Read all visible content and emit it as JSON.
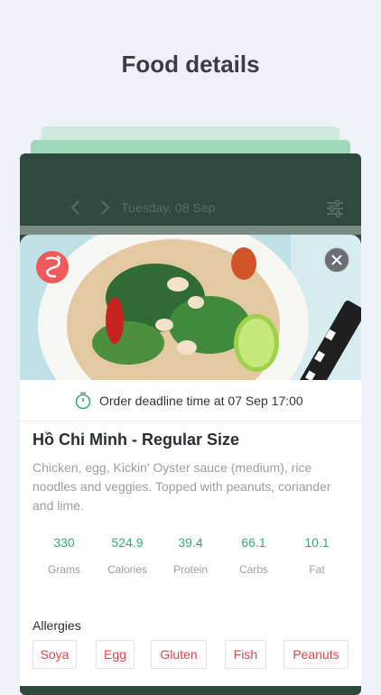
{
  "headline": "Food details",
  "topbar": {
    "date": "Tuesday, 08 Sep",
    "prev_icon": "chevron-left-icon",
    "next_icon": "chevron-right-icon",
    "filter_icon": "sliders-icon"
  },
  "card": {
    "deadline": "Order deadline time at 07 Sep 17:00",
    "title": "Hồ Chi Minh - Regular Size",
    "description": "Chicken, egg, Kickin' Oyster sauce (medium), rice noodles and veggies. Topped with peanuts, coriander and lime.",
    "nutrition": [
      {
        "value": "330",
        "label": "Grams"
      },
      {
        "value": "524.9",
        "label": "Calories"
      },
      {
        "value": "39.4",
        "label": "Protein"
      },
      {
        "value": "66.1",
        "label": "Carbs"
      },
      {
        "value": "10.1",
        "label": "Fat"
      }
    ],
    "allergies_title": "Allergies",
    "allergens": [
      "Soya",
      "Egg",
      "Gluten",
      "Fish",
      "Peanuts"
    ]
  },
  "colors": {
    "accent_green": "#3aa876",
    "allergen_red": "#e0454d",
    "app_dark": "#2f4a3d"
  }
}
